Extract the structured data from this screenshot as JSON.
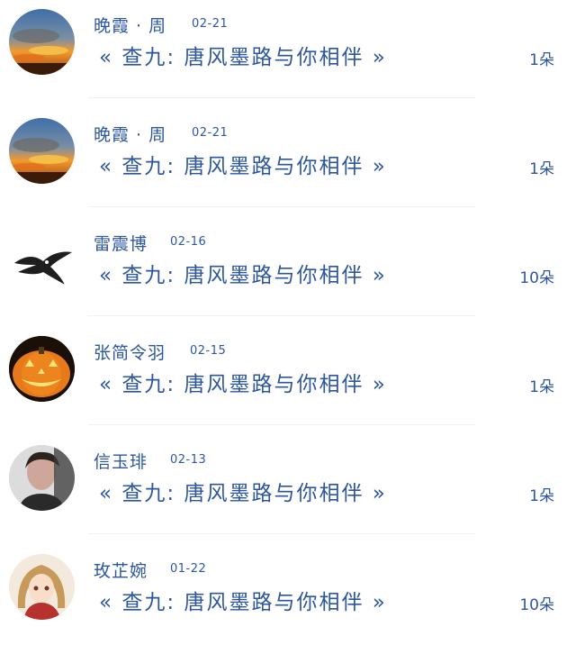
{
  "records": [
    {
      "name": "晚霞 · 周",
      "date": "02-21",
      "title": "«  查九:  唐风墨路与你相伴  »",
      "count": "1朵",
      "avatar": "sunset-avatar"
    },
    {
      "name": "晚霞 · 周",
      "date": "02-21",
      "title": "«  查九:  唐风墨路与你相伴  »",
      "count": "1朵",
      "avatar": "sunset-avatar"
    },
    {
      "name": "雷震博",
      "date": "02-16",
      "title": "«  查九:  唐风墨路与你相伴  »",
      "count": "10朵",
      "avatar": "swallow-bird-avatar"
    },
    {
      "name": "张简令羽",
      "date": "02-15",
      "title": "«  查九:  唐风墨路与你相伴  »",
      "count": "1朵",
      "avatar": "pumpkin-lantern-avatar"
    },
    {
      "name": "信玉琲",
      "date": "02-13",
      "title": "«  查九:  唐风墨路与你相伴  »",
      "count": "1朵",
      "avatar": "man-portrait-avatar"
    },
    {
      "name": "玫芷婉",
      "date": "01-22",
      "title": "«  查九:  唐风墨路与你相伴  »",
      "count": "10朵",
      "avatar": "anime-girl-avatar"
    }
  ]
}
